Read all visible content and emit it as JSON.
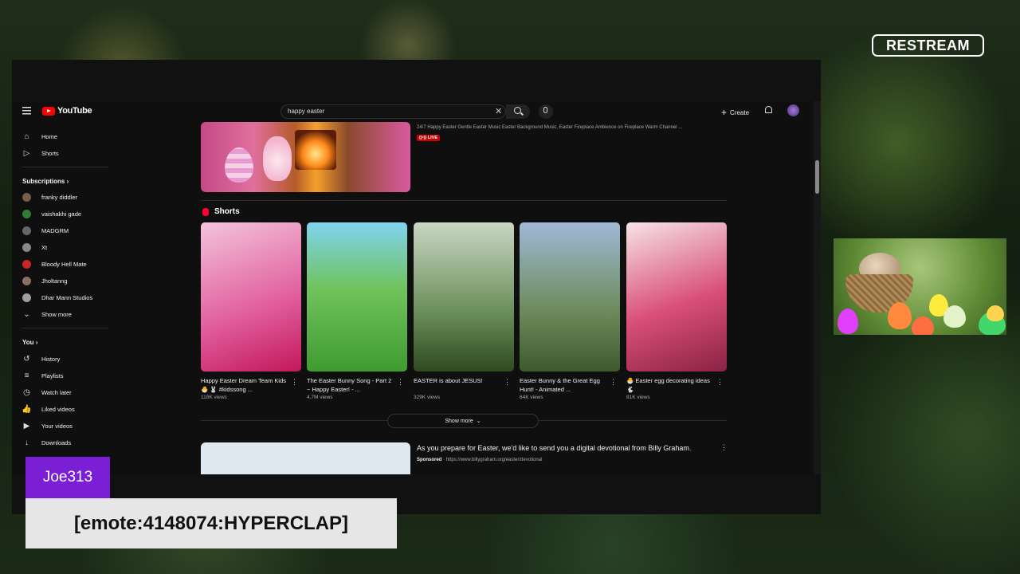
{
  "overlay": {
    "brand": "RESTREAM",
    "chat_username": "Joe313",
    "chat_message": "[emote:4148074:HYPERCLAP]"
  },
  "youtube": {
    "logo_text": "YouTube",
    "search": {
      "value": "happy easter",
      "clear_icon": "close-icon",
      "search_icon": "search-icon",
      "mic_icon": "mic-icon"
    },
    "header_right": {
      "create_label": "Create",
      "bell_icon": "bell-icon"
    },
    "sidebar": {
      "main_items": [
        {
          "icon": "home-icon",
          "label": "Home"
        },
        {
          "icon": "shorts-icon",
          "label": "Shorts"
        }
      ],
      "subscriptions_heading": "Subscriptions",
      "subscriptions": [
        {
          "label": "franky diddler",
          "color": "#7a5a4a"
        },
        {
          "label": "vaishakhi gade",
          "color": "#2f7d32"
        },
        {
          "label": "MADGRM",
          "color": "#666666"
        },
        {
          "label": "Xt",
          "color": "#888888"
        },
        {
          "label": "Bloody Hell Mate",
          "color": "#c62828"
        },
        {
          "label": "Jholtanng",
          "color": "#8d6e63"
        },
        {
          "label": "Dhar Mann Studios",
          "color": "#9e9e9e"
        }
      ],
      "show_more_label": "Show more",
      "you_heading": "You",
      "you_items": [
        {
          "icon": "history-icon",
          "label": "History"
        },
        {
          "icon": "playlists-icon",
          "label": "Playlists"
        },
        {
          "icon": "watch-later-icon",
          "label": "Watch later"
        },
        {
          "icon": "like-icon",
          "label": "Liked videos"
        },
        {
          "icon": "your-videos-icon",
          "label": "Your videos"
        },
        {
          "icon": "download-icon",
          "label": "Downloads"
        }
      ]
    },
    "live_result": {
      "description": "24/7 Happy Easter Gentle Easter Music Easter Background Music, Easter Fireplace Ambience on Fireplace Warm Channel ...",
      "badge": "LIVE"
    },
    "shorts": {
      "heading": "Shorts",
      "items": [
        {
          "title": "Happy Easter Dream Team Kids 🐣 🐰 #kidssong ...",
          "views": "118K views",
          "bg": "linear-gradient(160deg,#f3c4dd,#e05b9a 60%,#c2185b)"
        },
        {
          "title": "The Easter Bunny Song - Part 2 ~ Happy Easter! - ...",
          "views": "4.7M views",
          "bg": "linear-gradient(180deg,#7fd3f0 0%,#6fc35a 45%,#3f9b2f 100%)"
        },
        {
          "title": "EASTER is about JESUS!",
          "views": "329K views",
          "bg": "linear-gradient(180deg,#c9d6c3 0%,#6b8f5a 60%,#2e4a1f 100%)"
        },
        {
          "title": "Easter Bunny & the Great Egg Hunt! - Animated ...",
          "views": "64K views",
          "bg": "linear-gradient(180deg,#9fb9d6 0%,#6c8a5a 60%,#3d5a2d 100%)"
        },
        {
          "title": "🐣 Easter egg decorating ideas 🐇",
          "views": "81K views",
          "bg": "linear-gradient(160deg,#f6e3e8,#d94f7a 55%,#8a2244)"
        }
      ],
      "show_more_label": "Show more"
    },
    "ad": {
      "title": "As you prepare for Easter, we'd like to send you a digital devotional from Billy Graham.",
      "sponsored_label": "Sponsored",
      "url": "https://www.billygraham.org/easter/devotional"
    }
  }
}
